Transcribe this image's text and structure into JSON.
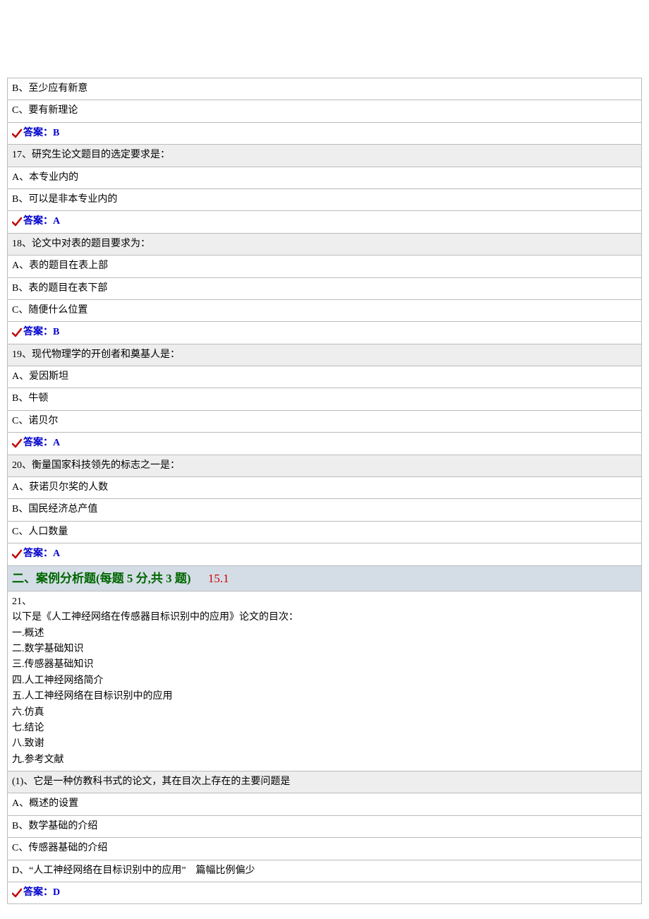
{
  "q16": {
    "options": {
      "b": "B、至少应有新意",
      "c": "C、要有新理论"
    },
    "answer": "答案：B"
  },
  "q17": {
    "text": "17、研究生论文题目的选定要求是：",
    "options": {
      "a": "A、本专业内的",
      "b": "B、可以是非本专业内的"
    },
    "answer": "答案：A"
  },
  "q18": {
    "text": "18、论文中对表的题目要求为：",
    "options": {
      "a": "A、表的题目在表上部",
      "b": "B、表的题目在表下部",
      "c": "C、随便什么位置"
    },
    "answer": "答案：B"
  },
  "q19": {
    "text": "19、现代物理学的开创者和奠基人是：",
    "options": {
      "a": "A、爱因斯坦",
      "b": "B、牛顿",
      "c": "C、诺贝尔"
    },
    "answer": "答案：A"
  },
  "q20": {
    "text": "20、衡量国家科技领先的标志之一是：",
    "options": {
      "a": "A、获诺贝尔奖的人数",
      "b": "B、国民经济总产值",
      "c": "C、人口数量"
    },
    "answer": "答案：A"
  },
  "section2": {
    "title": "二、案例分析题(每题 5 分,共 3 题)",
    "score": "15.1"
  },
  "q21": {
    "num": "21、",
    "intro_lines": [
      "以下是《人工神经网络在传感器目标识别中的应用》论文的目次：",
      "一.概述",
      "二.数学基础知识",
      "三.传感器基础知识",
      "四.人工神经网络简介",
      "五.人工神经网络在目标识别中的应用",
      "六.仿真",
      "七.结论",
      "八.致谢",
      "九.参考文献"
    ],
    "sub1": {
      "text": "(1)、它是一种仿教科书式的论文，其在目次上存在的主要问题是",
      "options": {
        "a": "A、概述的设置",
        "b": "B、数学基础的介绍",
        "c": "C、传感器基础的介绍",
        "d": "D、“人工神经网络在目标识别中的应用” 篇幅比例偏少"
      },
      "answer": "答案：D"
    }
  }
}
